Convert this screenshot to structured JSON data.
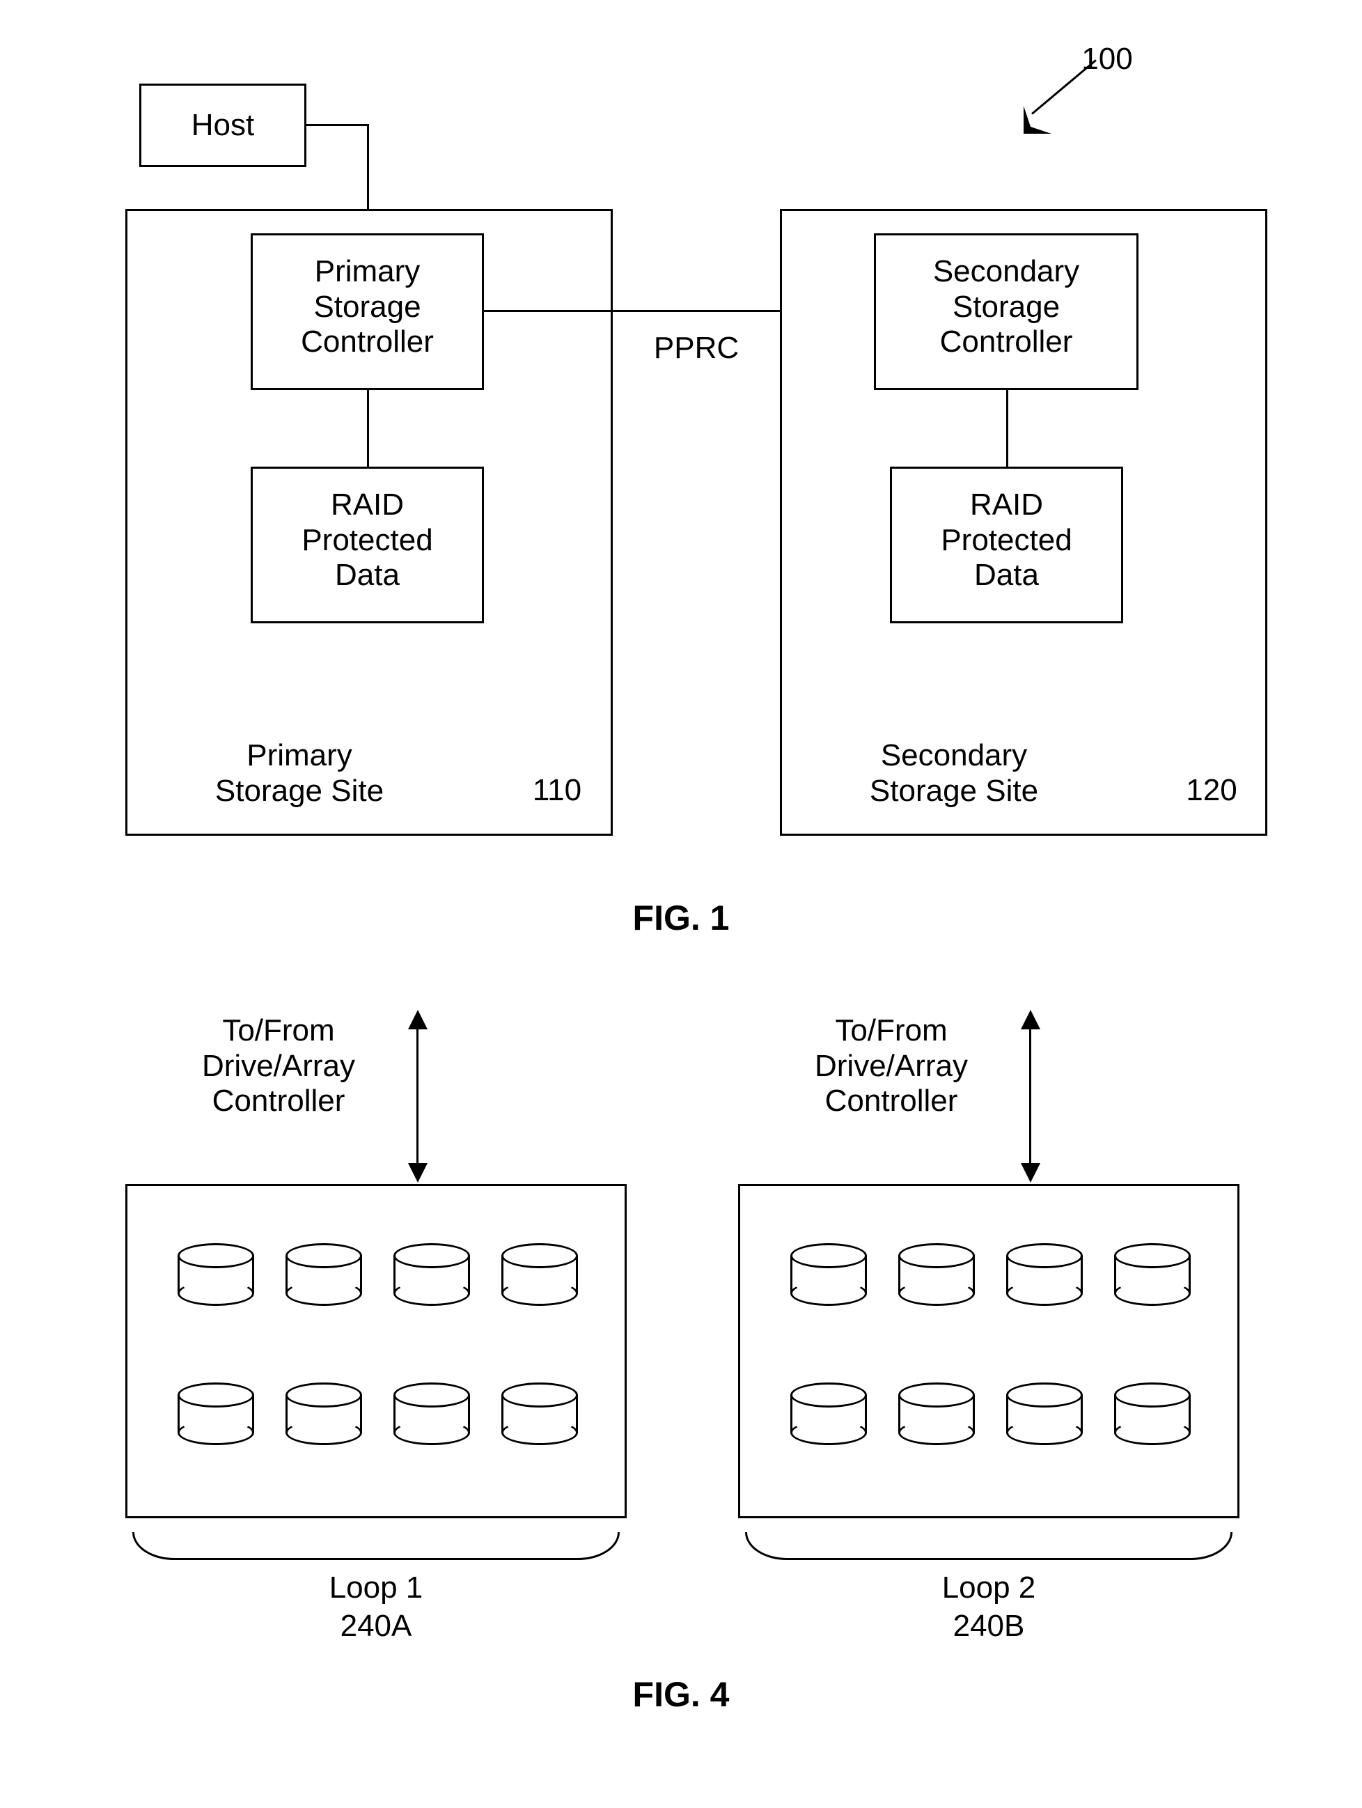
{
  "fig1": {
    "system_ref": "100",
    "host_label": "Host",
    "primary": {
      "controller": "Primary\nStorage\nController",
      "raid": "RAID\nProtected\nData",
      "site_label": "Primary\nStorage Site",
      "site_ref": "110"
    },
    "secondary": {
      "controller": "Secondary\nStorage\nController",
      "raid": "RAID\nProtected\nData",
      "site_label": "Secondary\nStorage Site",
      "site_ref": "120"
    },
    "link_label": "PPRC",
    "caption": "FIG. 1"
  },
  "fig4": {
    "arrow_label": "To/From\nDrive/Array\nController",
    "loop1": {
      "name": "Loop 1",
      "ref": "240A"
    },
    "loop2": {
      "name": "Loop 2",
      "ref": "240B"
    },
    "caption": "FIG. 4"
  }
}
